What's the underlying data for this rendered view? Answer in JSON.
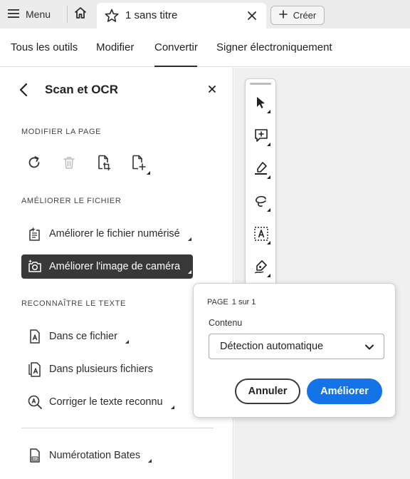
{
  "titlebar": {
    "menu_label": "Menu",
    "tab_title": "1 sans titre",
    "create_label": "Créer"
  },
  "main_nav": {
    "items": [
      "Tous les outils",
      "Modifier",
      "Convertir",
      "Signer électroniquement"
    ],
    "active": "Convertir"
  },
  "panel": {
    "title": "Scan et OCR",
    "section_modify": "MODIFIER LA PAGE",
    "section_improve": "AMÉLIORER LE FICHIER",
    "improve_items": [
      "Améliorer le fichier numérisé",
      "Améliorer l'image de caméra"
    ],
    "selected_item": "Améliorer l'image de caméra",
    "section_recognize": "RECONNAÎTRE LE TEXTE",
    "recognize_items": [
      "Dans ce fichier",
      "Dans plusieurs fichiers",
      "Corriger le texte reconnu"
    ],
    "bates_label": "Numérotation Bates"
  },
  "popover": {
    "page_label": "PAGE",
    "page_value": "1 sur 1",
    "content_label": "Contenu",
    "content_selected": "Détection automatique",
    "cancel_label": "Annuler",
    "confirm_label": "Améliorer"
  },
  "colors": {
    "accent": "#1473e6",
    "selected_bg": "#383838",
    "titlebar_bg": "#ececec",
    "canvas_bg": "#f0f0f0"
  },
  "icons": {
    "menu": "hamburger-icon",
    "home": "home-icon",
    "favorite": "star-icon",
    "tab_close": "close-icon",
    "create": "plus-icon",
    "back": "chevron-left-icon",
    "panel_close": "close-icon",
    "page_tools": [
      "rotate-icon",
      "trash-icon",
      "crop-page-icon",
      "insert-page-icon"
    ],
    "toolbar": [
      "select-cursor-icon",
      "add-comment-icon",
      "highlight-icon",
      "draw-lasso-icon",
      "text-box-icon",
      "sign-icon"
    ]
  }
}
